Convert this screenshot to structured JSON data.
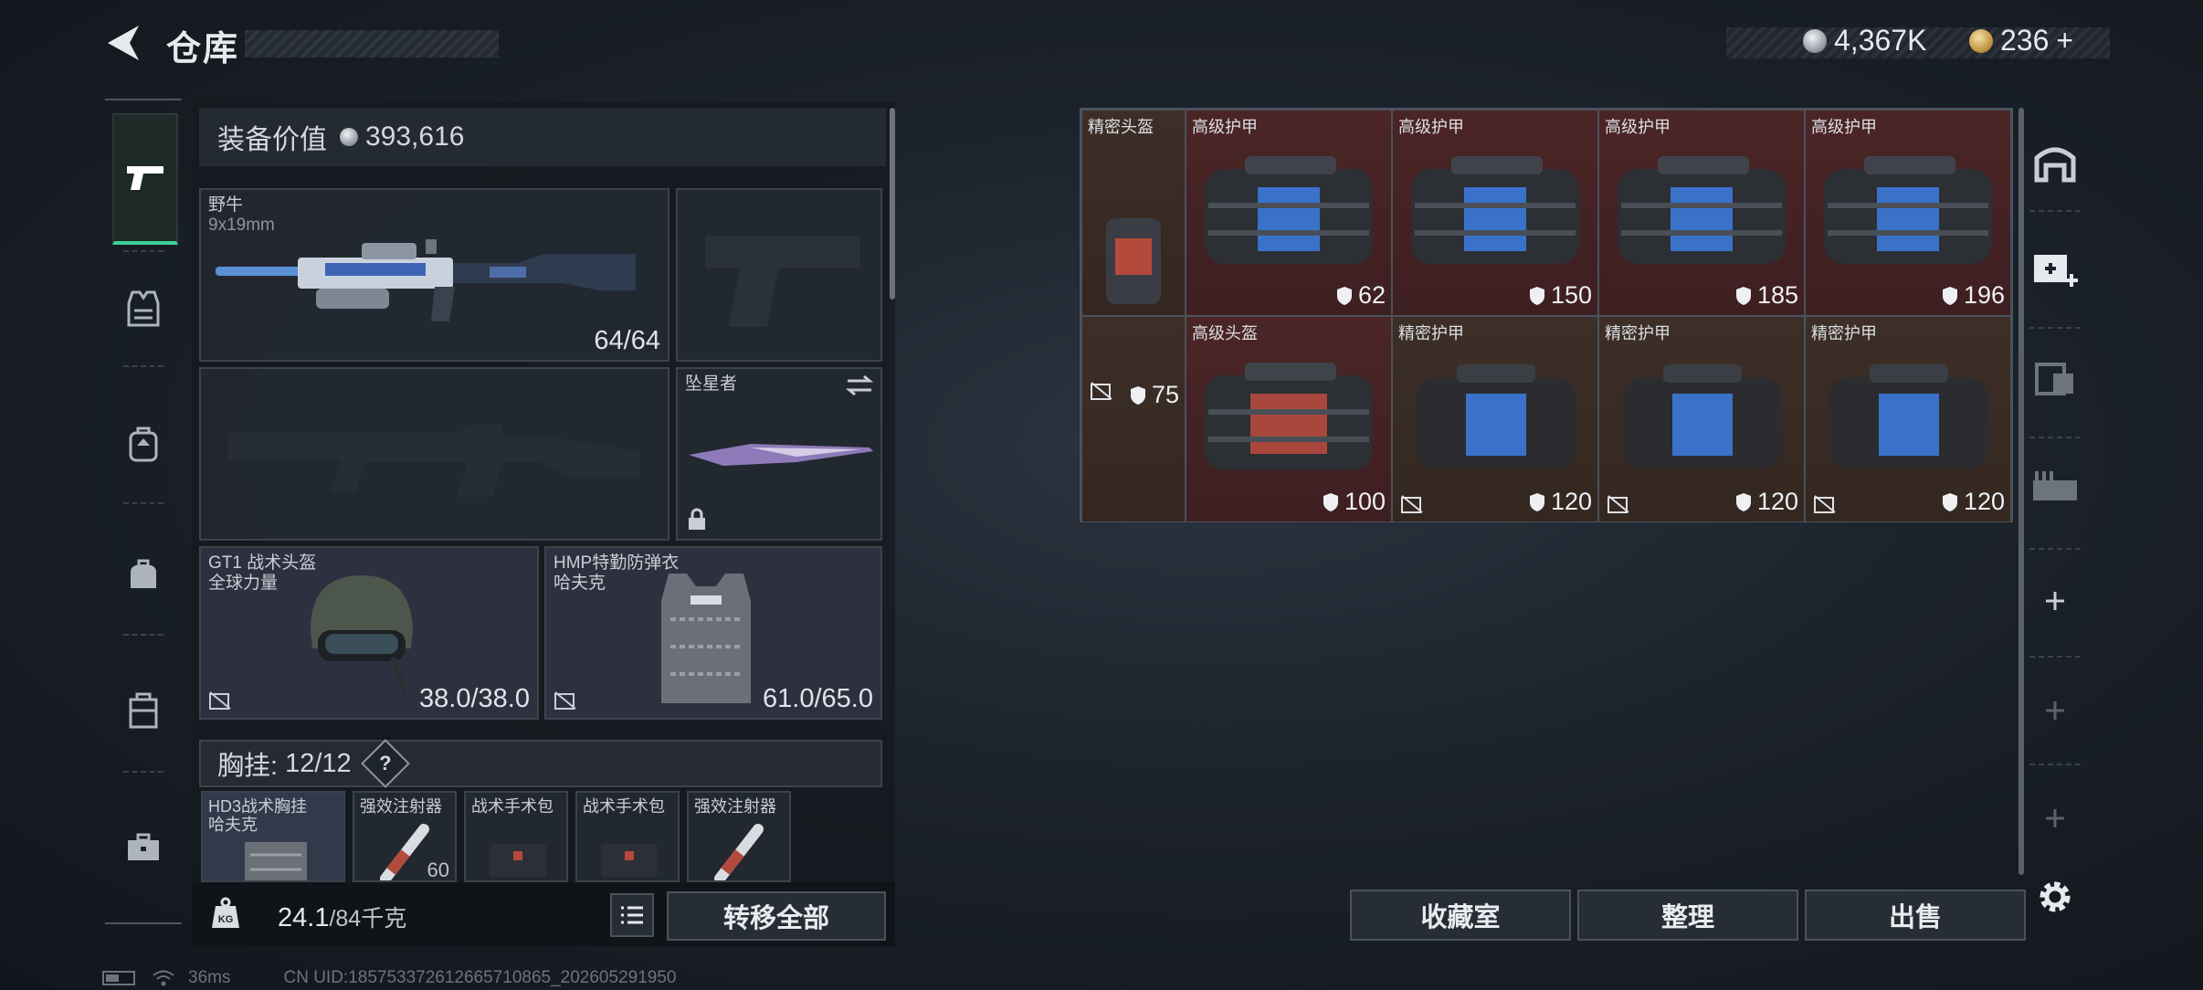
{
  "header": {
    "title": "仓库",
    "silver_amount": "4,367K",
    "gold_amount": "236",
    "gold_add": "+"
  },
  "equip_value": {
    "label": "装备价值",
    "value": "393,616"
  },
  "slots": {
    "primary": {
      "name": "野牛",
      "ammo_type": "9x19mm",
      "ammo": "64/64"
    },
    "melee": {
      "name": "坠星者"
    },
    "helmet": {
      "name": "GT1 战术头盔",
      "brand": "全球力量",
      "durability": "38.0/38.0"
    },
    "armor": {
      "name": "HMP特勤防弹衣",
      "brand": "哈夫克",
      "durability": "61.0/65.0"
    }
  },
  "chest_rig": {
    "label": "胸挂:",
    "count": "12/12",
    "help": "?"
  },
  "chest_items": [
    {
      "name": "HD3战术胸挂",
      "sub": "哈夫克"
    },
    {
      "name": "强效注射器",
      "qty": "60"
    },
    {
      "name": "战术手术包"
    },
    {
      "name": "战术手术包"
    },
    {
      "name": "强效注射器"
    }
  ],
  "bottom": {
    "weight": "24.1",
    "capacity": "/84千克",
    "transfer_all": "转移全部"
  },
  "storage": {
    "cells": [
      {
        "label": "精密头盔",
        "durability": "75"
      },
      {
        "label": "高级护甲",
        "durability": "62"
      },
      {
        "label": "高级护甲",
        "durability": "150"
      },
      {
        "label": "高级护甲",
        "durability": "185"
      },
      {
        "label": "高级护甲",
        "durability": "196"
      },
      {
        "label": "高级头盔",
        "durability": "100"
      },
      {
        "label": "精密护甲",
        "durability": "120"
      },
      {
        "label": "精密护甲",
        "durability": "120"
      },
      {
        "label": "精密护甲",
        "durability": "120"
      }
    ]
  },
  "actions": {
    "collection": "收藏室",
    "organize": "整理",
    "sell": "出售"
  },
  "status": {
    "ping": "36ms",
    "uid": "CN UID:18575337261266571086​5_202605291950"
  },
  "colors": {
    "accent": "#3ad39a",
    "red_cell": "#4b2526",
    "brown_cell": "#3d2f28"
  }
}
